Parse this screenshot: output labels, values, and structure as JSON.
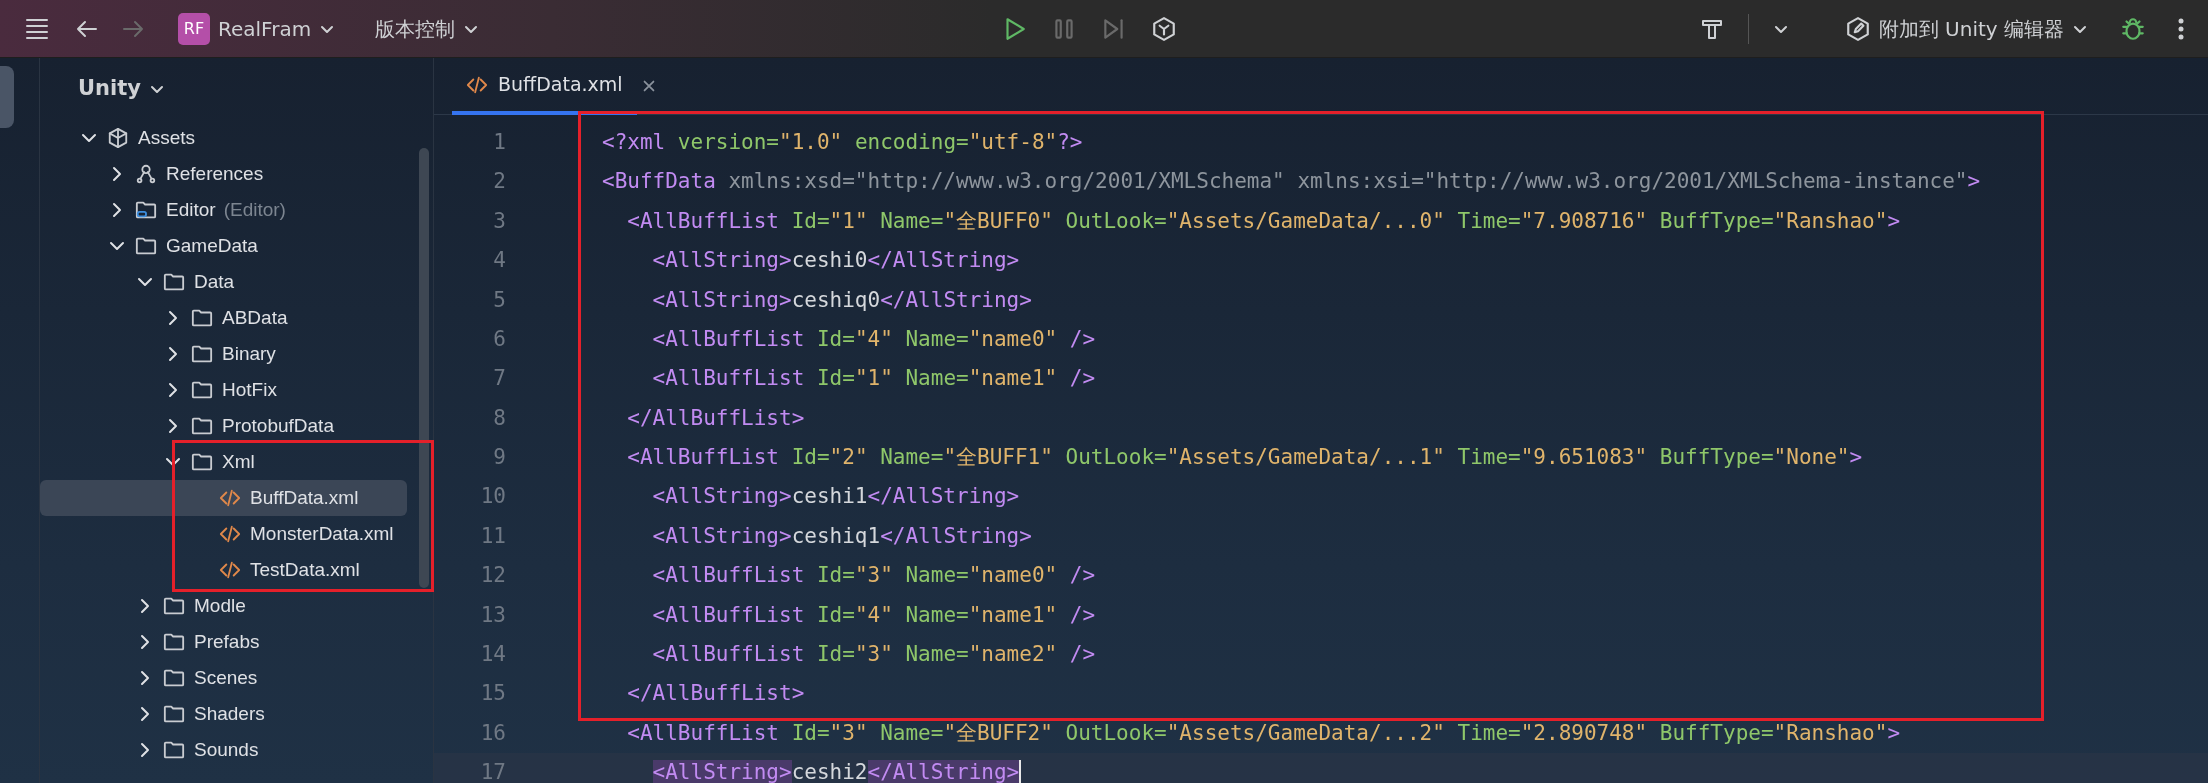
{
  "toolbar": {
    "nav": [
      {
        "kind": "back",
        "disabled": false
      },
      {
        "kind": "forward",
        "disabled": true
      }
    ],
    "project": {
      "badge": "RF",
      "name": "RealFram"
    },
    "vcs": "版本控制",
    "run_controls": [
      {
        "kind": "run",
        "disabled": false
      },
      {
        "kind": "pause",
        "disabled": true
      },
      {
        "kind": "step",
        "disabled": true
      },
      {
        "kind": "unity",
        "disabled": false
      }
    ],
    "attach": "附加到 Unity 编辑器"
  },
  "sidebar": {
    "title": "Unity",
    "highlight_box": true,
    "tree": [
      {
        "name": "Assets",
        "kind": "assets",
        "expanded": true,
        "selected": false,
        "children": [
          {
            "name": "References",
            "kind": "references",
            "expanded": false,
            "selected": false
          },
          {
            "name": "Editor",
            "hint": "(Editor)",
            "kind": "editor-folder",
            "expanded": false,
            "selected": false
          },
          {
            "name": "GameData",
            "kind": "folder",
            "expanded": true,
            "selected": false,
            "children": [
              {
                "name": "Data",
                "kind": "folder",
                "expanded": true,
                "selected": false,
                "children": [
                  {
                    "name": "ABData",
                    "kind": "folder",
                    "expanded": false,
                    "selected": false
                  },
                  {
                    "name": "Binary",
                    "kind": "folder",
                    "expanded": false,
                    "selected": false
                  },
                  {
                    "name": "HotFix",
                    "kind": "folder",
                    "expanded": false,
                    "selected": false
                  },
                  {
                    "name": "ProtobufData",
                    "kind": "folder",
                    "expanded": false,
                    "selected": false
                  },
                  {
                    "name": "Xml",
                    "kind": "folder",
                    "expanded": true,
                    "selected": false,
                    "boxed": true,
                    "children": [
                      {
                        "name": "BuffData.xml",
                        "kind": "xml",
                        "selected": true
                      },
                      {
                        "name": "MonsterData.xml",
                        "kind": "xml",
                        "selected": false
                      },
                      {
                        "name": "TestData.xml",
                        "kind": "xml",
                        "selected": false
                      }
                    ]
                  }
                ]
              },
              {
                "name": "Modle",
                "kind": "folder",
                "expanded": false,
                "selected": false
              },
              {
                "name": "Prefabs",
                "kind": "folder",
                "expanded": false,
                "selected": false
              },
              {
                "name": "Scenes",
                "kind": "folder",
                "expanded": false,
                "selected": false
              },
              {
                "name": "Shaders",
                "kind": "folder",
                "expanded": false,
                "selected": false
              },
              {
                "name": "Sounds",
                "kind": "folder",
                "expanded": false,
                "selected": false
              }
            ]
          }
        ]
      }
    ]
  },
  "editor": {
    "tabs": [
      {
        "label": "BuffData.xml",
        "selected": true
      }
    ],
    "highlight_box": true,
    "lines": [
      {
        "number": "1",
        "tokens": [
          {
            "kind": "tag",
            "text": "<?xml"
          },
          {
            "kind": "attr",
            "text": " version="
          },
          {
            "kind": "value",
            "text": "\"1.0\""
          },
          {
            "kind": "attr",
            "text": " encoding="
          },
          {
            "kind": "value",
            "text": "\"utf-8\""
          },
          {
            "kind": "tag",
            "text": "?>"
          }
        ]
      },
      {
        "number": "2",
        "tokens": [
          {
            "kind": "tag",
            "text": "<BuffData"
          },
          {
            "kind": "ns",
            "text": " xmlns:xsd=\"http://www.w3.org/2001/XMLSchema\" xmlns:xsi=\"http://www.w3.org/2001/XMLSchema-instance\""
          },
          {
            "kind": "tag",
            "text": ">"
          }
        ]
      },
      {
        "number": "3",
        "tokens": [
          {
            "kind": "tag",
            "text": "  <AllBuffList"
          },
          {
            "kind": "attr",
            "text": " Id="
          },
          {
            "kind": "value",
            "text": "\"1\""
          },
          {
            "kind": "attr",
            "text": " Name="
          },
          {
            "kind": "value",
            "text": "\"全BUFF0\""
          },
          {
            "kind": "attr",
            "text": " OutLook="
          },
          {
            "kind": "value",
            "text": "\"Assets/GameData/...0\""
          },
          {
            "kind": "attr",
            "text": " Time="
          },
          {
            "kind": "value",
            "text": "\"7.908716\""
          },
          {
            "kind": "attr",
            "text": " BuffType="
          },
          {
            "kind": "value",
            "text": "\"Ranshao\""
          },
          {
            "kind": "tag",
            "text": ">"
          }
        ]
      },
      {
        "number": "4",
        "tokens": [
          {
            "kind": "tag",
            "text": "    <AllString>"
          },
          {
            "kind": "text",
            "text": "ceshi0"
          },
          {
            "kind": "tag",
            "text": "</AllString>"
          }
        ]
      },
      {
        "number": "5",
        "tokens": [
          {
            "kind": "tag",
            "text": "    <AllString>"
          },
          {
            "kind": "text",
            "text": "ceshiq0"
          },
          {
            "kind": "tag",
            "text": "</AllString>"
          }
        ]
      },
      {
        "number": "6",
        "tokens": [
          {
            "kind": "tag",
            "text": "    <AllBuffList"
          },
          {
            "kind": "attr",
            "text": " Id="
          },
          {
            "kind": "value",
            "text": "\"4\""
          },
          {
            "kind": "attr",
            "text": " Name="
          },
          {
            "kind": "value",
            "text": "\"name0\""
          },
          {
            "kind": "tag",
            "text": " />"
          }
        ]
      },
      {
        "number": "7",
        "tokens": [
          {
            "kind": "tag",
            "text": "    <AllBuffList"
          },
          {
            "kind": "attr",
            "text": " Id="
          },
          {
            "kind": "value",
            "text": "\"1\""
          },
          {
            "kind": "attr",
            "text": " Name="
          },
          {
            "kind": "value",
            "text": "\"name1\""
          },
          {
            "kind": "tag",
            "text": " />"
          }
        ]
      },
      {
        "number": "8",
        "tokens": [
          {
            "kind": "tag",
            "text": "  </AllBuffList>"
          }
        ]
      },
      {
        "number": "9",
        "tokens": [
          {
            "kind": "tag",
            "text": "  <AllBuffList"
          },
          {
            "kind": "attr",
            "text": " Id="
          },
          {
            "kind": "value",
            "text": "\"2\""
          },
          {
            "kind": "attr",
            "text": " Name="
          },
          {
            "kind": "value",
            "text": "\"全BUFF1\""
          },
          {
            "kind": "attr",
            "text": " OutLook="
          },
          {
            "kind": "value",
            "text": "\"Assets/GameData/...1\""
          },
          {
            "kind": "attr",
            "text": " Time="
          },
          {
            "kind": "value",
            "text": "\"9.651083\""
          },
          {
            "kind": "attr",
            "text": " BuffType="
          },
          {
            "kind": "value",
            "text": "\"None\""
          },
          {
            "kind": "tag",
            "text": ">"
          }
        ]
      },
      {
        "number": "10",
        "tokens": [
          {
            "kind": "tag",
            "text": "    <AllString>"
          },
          {
            "kind": "text",
            "text": "ceshi1"
          },
          {
            "kind": "tag",
            "text": "</AllString>"
          }
        ]
      },
      {
        "number": "11",
        "tokens": [
          {
            "kind": "tag",
            "text": "    <AllString>"
          },
          {
            "kind": "text",
            "text": "ceshiq1"
          },
          {
            "kind": "tag",
            "text": "</AllString>"
          }
        ]
      },
      {
        "number": "12",
        "tokens": [
          {
            "kind": "tag",
            "text": "    <AllBuffList"
          },
          {
            "kind": "attr",
            "text": " Id="
          },
          {
            "kind": "value",
            "text": "\"3\""
          },
          {
            "kind": "attr",
            "text": " Name="
          },
          {
            "kind": "value",
            "text": "\"name0\""
          },
          {
            "kind": "tag",
            "text": " />"
          }
        ]
      },
      {
        "number": "13",
        "tokens": [
          {
            "kind": "tag",
            "text": "    <AllBuffList"
          },
          {
            "kind": "attr",
            "text": " Id="
          },
          {
            "kind": "value",
            "text": "\"4\""
          },
          {
            "kind": "attr",
            "text": " Name="
          },
          {
            "kind": "value",
            "text": "\"name1\""
          },
          {
            "kind": "tag",
            "text": " />"
          }
        ]
      },
      {
        "number": "14",
        "tokens": [
          {
            "kind": "tag",
            "text": "    <AllBuffList"
          },
          {
            "kind": "attr",
            "text": " Id="
          },
          {
            "kind": "value",
            "text": "\"3\""
          },
          {
            "kind": "attr",
            "text": " Name="
          },
          {
            "kind": "value",
            "text": "\"name2\""
          },
          {
            "kind": "tag",
            "text": " />"
          }
        ]
      },
      {
        "number": "15",
        "tokens": [
          {
            "kind": "tag",
            "text": "  </AllBuffList>"
          }
        ]
      },
      {
        "number": "16",
        "tokens": [
          {
            "kind": "tag",
            "text": "  <AllBuffList"
          },
          {
            "kind": "attr",
            "text": " Id="
          },
          {
            "kind": "value",
            "text": "\"3\""
          },
          {
            "kind": "attr",
            "text": " Name="
          },
          {
            "kind": "value",
            "text": "\"全BUFF2\""
          },
          {
            "kind": "attr",
            "text": " OutLook="
          },
          {
            "kind": "value",
            "text": "\"Assets/GameData/...2\""
          },
          {
            "kind": "attr",
            "text": " Time="
          },
          {
            "kind": "value",
            "text": "\"2.890748\""
          },
          {
            "kind": "attr",
            "text": " BuffType="
          },
          {
            "kind": "value",
            "text": "\"Ranshao\""
          },
          {
            "kind": "tag",
            "text": ">"
          }
        ]
      },
      {
        "number": "17",
        "current": true,
        "tokens": [
          {
            "kind": "tag",
            "text": "    <AllString>",
            "matched": true
          },
          {
            "kind": "text",
            "text": "ceshi2"
          },
          {
            "kind": "tag",
            "text": "</AllString>",
            "matched": true
          }
        ]
      }
    ]
  }
}
